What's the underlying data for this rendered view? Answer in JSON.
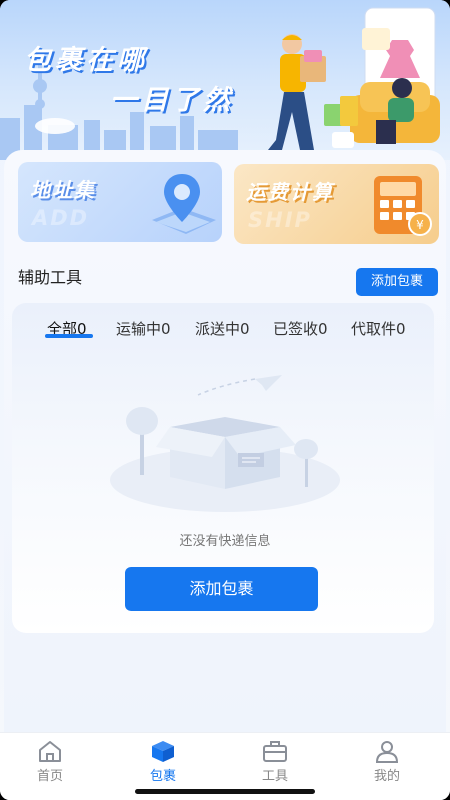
{
  "banner": {
    "title_line1": "包裹在哪",
    "title_line2": "一目了然"
  },
  "cards": {
    "address": {
      "title": "地址集",
      "watermark": "ADD"
    },
    "shipping": {
      "title": "运费计算",
      "watermark": "SHIP"
    }
  },
  "tools": {
    "section_title": "辅助工具",
    "add_label": "添加包裹"
  },
  "tabs": [
    {
      "label": "全部0",
      "active": true
    },
    {
      "label": "运输中0"
    },
    {
      "label": "派送中0"
    },
    {
      "label": "已签收0"
    },
    {
      "label": "代取件0"
    }
  ],
  "empty": {
    "message": "还没有快递信息",
    "button_label": "添加包裹"
  },
  "nav": [
    {
      "label": "首页",
      "icon": "home-icon"
    },
    {
      "label": "包裹",
      "icon": "package-icon",
      "active": true
    },
    {
      "label": "工具",
      "icon": "toolbox-icon"
    },
    {
      "label": "我的",
      "icon": "user-icon"
    }
  ],
  "colors": {
    "accent": "#1677ef",
    "fee_card": "#f6cd8c",
    "address_card": "#b7d2fb"
  }
}
